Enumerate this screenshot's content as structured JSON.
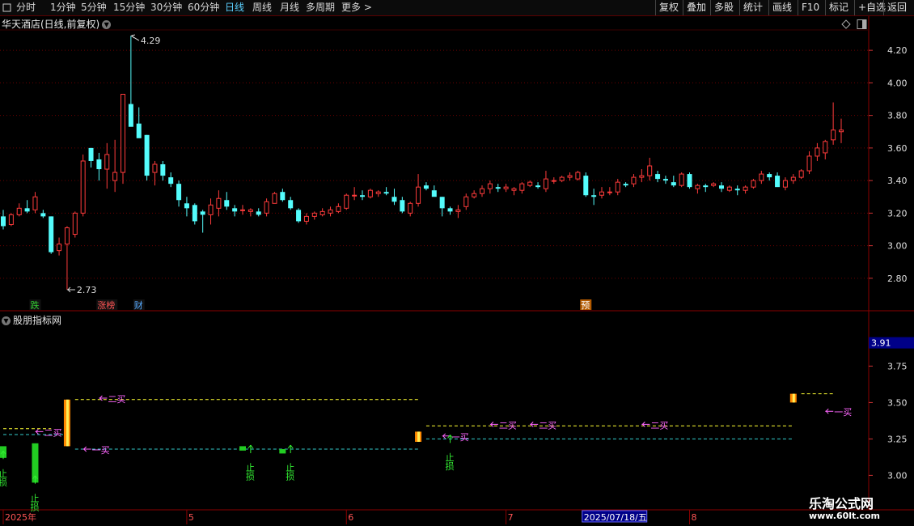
{
  "toolbar": {
    "left_items": [
      "分时",
      "1分钟",
      "5分钟",
      "15分钟",
      "30分钟",
      "60分钟",
      "日线",
      "周线",
      "月线",
      "多周期",
      "更多 >"
    ],
    "active_item": "日线",
    "right_items": [
      "复权",
      "叠加",
      "多股",
      "统计",
      "画线",
      "F10",
      "标记",
      "+自选",
      "返回"
    ]
  },
  "stock_title": "华天酒店(日线,前复权)",
  "indicator_title": "股朋指标网",
  "main_axis": {
    "ticks": [
      "4.20",
      "4.00",
      "3.80",
      "3.60",
      "3.40",
      "3.20",
      "3.00",
      "2.80"
    ],
    "values": [
      4.2,
      4.0,
      3.8,
      3.6,
      3.4,
      3.2,
      3.0,
      2.8
    ]
  },
  "indicator_axis": {
    "ticks": [
      "3.75",
      "3.50",
      "3.25",
      "3.00"
    ],
    "values": [
      3.75,
      3.5,
      3.25,
      3.0
    ],
    "current_value": "3.91"
  },
  "annotations": {
    "high": "4.29",
    "low": "2.73"
  },
  "event_tags": [
    {
      "label": "跌",
      "color": "#33cc33"
    },
    {
      "label": "涨榜",
      "color": "#ff5555"
    },
    {
      "label": "财",
      "color": "#55aaff"
    },
    {
      "label": "预",
      "color": "#ff9900"
    }
  ],
  "signals": {
    "buy2": "二买",
    "buy1": "一买",
    "stop": "止损"
  },
  "date_axis": {
    "labels": [
      "2025年",
      "5",
      "6",
      "7",
      "8"
    ],
    "cursor_date": "2025/07/18/五"
  },
  "watermark": {
    "title": "乐淘公式网",
    "url": "www.60lt.com"
  },
  "colors": {
    "up": "#ff3b3b",
    "down": "#54fcfc",
    "grid": "#6b0000",
    "yellow_line": "#ffff33",
    "cyan_line": "#33cccc",
    "buy_signal": "#ff66ff",
    "stop_signal": "#33ee33"
  },
  "chart_data": {
    "type": "candlestick",
    "price_unit": "元",
    "ohlc": [
      [
        3.18,
        3.22,
        3.1,
        3.12
      ],
      [
        3.13,
        3.2,
        3.12,
        3.19
      ],
      [
        3.19,
        3.26,
        3.18,
        3.23
      ],
      [
        3.23,
        3.28,
        3.2,
        3.21
      ],
      [
        3.22,
        3.33,
        3.2,
        3.3
      ],
      [
        3.2,
        3.22,
        3.17,
        3.18
      ],
      [
        3.18,
        3.18,
        2.95,
        2.96
      ],
      [
        2.97,
        3.05,
        2.94,
        3.01
      ],
      [
        3.01,
        3.12,
        2.73,
        3.11
      ],
      [
        3.07,
        3.21,
        3.05,
        3.2
      ],
      [
        3.2,
        3.56,
        3.18,
        3.52
      ],
      [
        3.6,
        3.6,
        3.48,
        3.52
      ],
      [
        3.53,
        3.57,
        3.4,
        3.47
      ],
      [
        3.47,
        3.63,
        3.35,
        3.56
      ],
      [
        3.4,
        3.65,
        3.33,
        3.45
      ],
      [
        3.45,
        3.93,
        3.38,
        3.93
      ],
      [
        3.87,
        4.29,
        3.82,
        3.73
      ],
      [
        3.75,
        3.85,
        3.67,
        3.66
      ],
      [
        3.68,
        3.68,
        3.4,
        3.43
      ],
      [
        3.45,
        3.52,
        3.37,
        3.5
      ],
      [
        3.5,
        3.52,
        3.4,
        3.43
      ],
      [
        3.42,
        3.45,
        3.36,
        3.38
      ],
      [
        3.38,
        3.4,
        3.24,
        3.28
      ],
      [
        3.26,
        3.3,
        3.18,
        3.23
      ],
      [
        3.25,
        3.26,
        3.13,
        3.15
      ],
      [
        3.21,
        3.22,
        3.08,
        3.19
      ],
      [
        3.19,
        3.29,
        3.13,
        3.25
      ],
      [
        3.23,
        3.34,
        3.18,
        3.29
      ],
      [
        3.28,
        3.33,
        3.22,
        3.24
      ],
      [
        3.23,
        3.25,
        3.18,
        3.21
      ],
      [
        3.22,
        3.25,
        3.19,
        3.22
      ],
      [
        3.21,
        3.23,
        3.18,
        3.22
      ],
      [
        3.21,
        3.23,
        3.18,
        3.19
      ],
      [
        3.2,
        3.29,
        3.18,
        3.27
      ],
      [
        3.26,
        3.33,
        3.26,
        3.32
      ],
      [
        3.33,
        3.35,
        3.27,
        3.28
      ],
      [
        3.28,
        3.3,
        3.22,
        3.23
      ],
      [
        3.22,
        3.23,
        3.14,
        3.15
      ],
      [
        3.15,
        3.2,
        3.13,
        3.18
      ],
      [
        3.18,
        3.21,
        3.16,
        3.2
      ],
      [
        3.19,
        3.23,
        3.18,
        3.21
      ],
      [
        3.2,
        3.24,
        3.18,
        3.22
      ],
      [
        3.21,
        3.26,
        3.2,
        3.24
      ],
      [
        3.23,
        3.32,
        3.22,
        3.31
      ],
      [
        3.31,
        3.36,
        3.28,
        3.31
      ],
      [
        3.31,
        3.34,
        3.28,
        3.3
      ],
      [
        3.3,
        3.35,
        3.29,
        3.34
      ],
      [
        3.32,
        3.34,
        3.3,
        3.33
      ],
      [
        3.33,
        3.36,
        3.31,
        3.32
      ],
      [
        3.3,
        3.35,
        3.25,
        3.27
      ],
      [
        3.28,
        3.3,
        3.2,
        3.21
      ],
      [
        3.2,
        3.27,
        3.18,
        3.26
      ],
      [
        3.26,
        3.44,
        3.24,
        3.36
      ],
      [
        3.37,
        3.39,
        3.34,
        3.35
      ],
      [
        3.34,
        3.37,
        3.31,
        3.3
      ],
      [
        3.3,
        3.3,
        3.18,
        3.23
      ],
      [
        3.23,
        3.24,
        3.19,
        3.21
      ],
      [
        3.21,
        3.25,
        3.17,
        3.22
      ],
      [
        3.24,
        3.32,
        3.22,
        3.3
      ],
      [
        3.3,
        3.34,
        3.29,
        3.32
      ],
      [
        3.32,
        3.37,
        3.3,
        3.35
      ],
      [
        3.35,
        3.4,
        3.32,
        3.38
      ],
      [
        3.36,
        3.38,
        3.33,
        3.35
      ],
      [
        3.35,
        3.38,
        3.33,
        3.36
      ],
      [
        3.34,
        3.36,
        3.31,
        3.35
      ],
      [
        3.34,
        3.39,
        3.32,
        3.38
      ],
      [
        3.37,
        3.4,
        3.36,
        3.39
      ],
      [
        3.37,
        3.39,
        3.35,
        3.36
      ],
      [
        3.35,
        3.46,
        3.33,
        3.41
      ],
      [
        3.4,
        3.42,
        3.38,
        3.4
      ],
      [
        3.4,
        3.43,
        3.39,
        3.42
      ],
      [
        3.42,
        3.45,
        3.4,
        3.43
      ],
      [
        3.41,
        3.46,
        3.4,
        3.45
      ],
      [
        3.43,
        3.45,
        3.3,
        3.31
      ],
      [
        3.31,
        3.35,
        3.25,
        3.3
      ],
      [
        3.31,
        3.36,
        3.29,
        3.33
      ],
      [
        3.33,
        3.36,
        3.31,
        3.33
      ],
      [
        3.33,
        3.41,
        3.31,
        3.39
      ],
      [
        3.38,
        3.39,
        3.36,
        3.37
      ],
      [
        3.38,
        3.44,
        3.36,
        3.42
      ],
      [
        3.42,
        3.47,
        3.39,
        3.43
      ],
      [
        3.43,
        3.54,
        3.4,
        3.49
      ],
      [
        3.44,
        3.46,
        3.39,
        3.41
      ],
      [
        3.41,
        3.43,
        3.38,
        3.4
      ],
      [
        3.39,
        3.43,
        3.36,
        3.37
      ],
      [
        3.37,
        3.45,
        3.36,
        3.44
      ],
      [
        3.44,
        3.45,
        3.35,
        3.36
      ],
      [
        3.35,
        3.38,
        3.32,
        3.37
      ],
      [
        3.37,
        3.38,
        3.33,
        3.36
      ],
      [
        3.37,
        3.39,
        3.36,
        3.38
      ],
      [
        3.37,
        3.39,
        3.33,
        3.35
      ],
      [
        3.34,
        3.37,
        3.33,
        3.36
      ],
      [
        3.35,
        3.37,
        3.31,
        3.34
      ],
      [
        3.34,
        3.37,
        3.32,
        3.36
      ],
      [
        3.36,
        3.41,
        3.35,
        3.4
      ],
      [
        3.4,
        3.46,
        3.38,
        3.44
      ],
      [
        3.44,
        3.45,
        3.4,
        3.42
      ],
      [
        3.43,
        3.45,
        3.37,
        3.36
      ],
      [
        3.36,
        3.42,
        3.34,
        3.4
      ],
      [
        3.4,
        3.44,
        3.38,
        3.42
      ],
      [
        3.42,
        3.47,
        3.41,
        3.46
      ],
      [
        3.46,
        3.58,
        3.44,
        3.55
      ],
      [
        3.55,
        3.63,
        3.52,
        3.6
      ],
      [
        3.57,
        3.65,
        3.53,
        3.64
      ],
      [
        3.65,
        3.88,
        3.62,
        3.71
      ],
      [
        3.7,
        3.78,
        3.63,
        3.71
      ]
    ],
    "price_range": [
      2.68,
      4.32
    ],
    "high_label": "4.29",
    "low_label": "2.73",
    "indicator": {
      "range": [
        2.93,
        4.03
      ],
      "current": 3.91,
      "bars": [
        {
          "i": 0,
          "from": 3.2,
          "to": 3.12,
          "color": "green"
        },
        {
          "i": 4,
          "from": 3.22,
          "to": 2.95,
          "color": "green"
        },
        {
          "i": 8,
          "from": 3.52,
          "to": 3.2,
          "color": "orange"
        },
        {
          "i": 30,
          "from": 3.2,
          "to": 3.17,
          "color": "green"
        },
        {
          "i": 35,
          "from": 3.18,
          "to": 3.15,
          "color": "green"
        },
        {
          "i": 52,
          "from": 3.3,
          "to": 3.23,
          "color": "orange"
        },
        {
          "i": 99,
          "from": 3.56,
          "to": 3.5,
          "color": "orange"
        }
      ],
      "lines": [
        {
          "from": 0,
          "to": 6,
          "value": 3.32,
          "color": "yellow"
        },
        {
          "from": 0,
          "to": 8,
          "value": 3.28,
          "color": "cyan"
        },
        {
          "from": 9,
          "to": 52,
          "value": 3.52,
          "color": "yellow"
        },
        {
          "from": 9,
          "to": 52,
          "value": 3.18,
          "color": "cyan"
        },
        {
          "from": 53,
          "to": 99,
          "value": 3.34,
          "color": "yellow"
        },
        {
          "from": 53,
          "to": 99,
          "value": 3.25,
          "color": "cyan"
        },
        {
          "from": 100,
          "to": 104,
          "value": 3.56,
          "color": "yellow"
        }
      ],
      "buy2_marks": [
        {
          "i": 4,
          "v": 3.3
        },
        {
          "i": 12,
          "v": 3.53
        },
        {
          "i": 61,
          "v": 3.35
        },
        {
          "i": 66,
          "v": 3.35
        },
        {
          "i": 80,
          "v": 3.35
        }
      ],
      "buy1_marks": [
        {
          "i": 10,
          "v": 3.18
        },
        {
          "i": 55,
          "v": 3.27
        },
        {
          "i": 103,
          "v": 3.44
        }
      ],
      "stop_marks": [
        {
          "i": 0,
          "v": 3.09
        },
        {
          "i": 4,
          "v": 2.92
        },
        {
          "i": 31,
          "v": 3.13
        },
        {
          "i": 36,
          "v": 3.13
        },
        {
          "i": 56,
          "v": 3.2
        }
      ]
    },
    "event_tag_indices": [
      4,
      13,
      17,
      73
    ],
    "date_label_indices": [
      0,
      23,
      43,
      63,
      86
    ],
    "cursor_index": 77
  }
}
